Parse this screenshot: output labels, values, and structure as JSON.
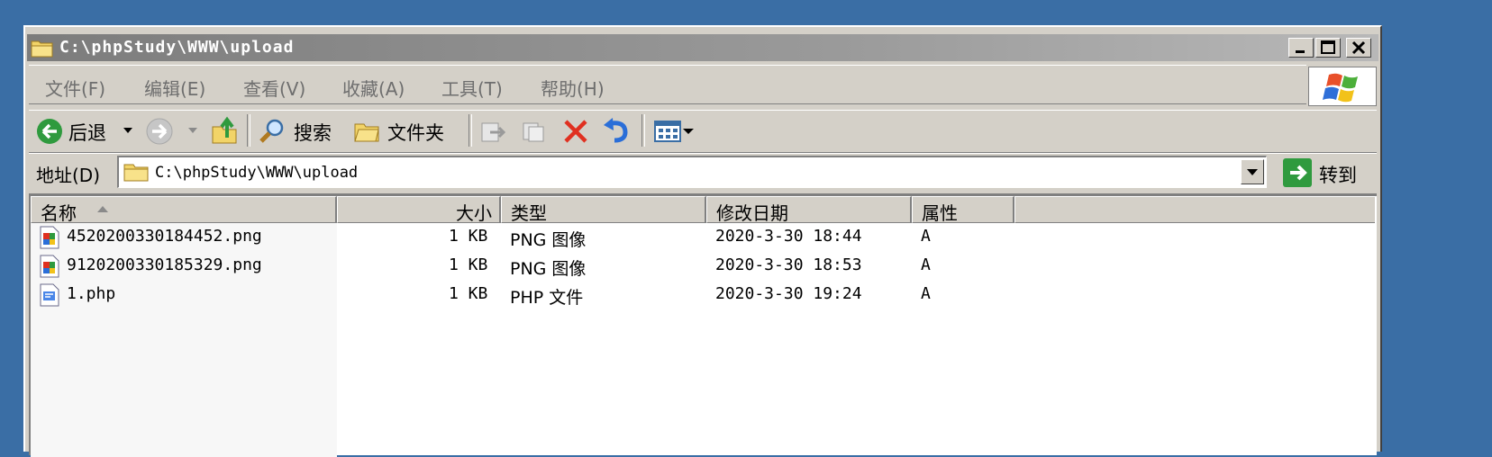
{
  "window": {
    "title": "C:\\phpStudy\\WWW\\upload",
    "controls": [
      "minimize",
      "maximize",
      "close"
    ]
  },
  "menu": [
    {
      "label": "文件(F)"
    },
    {
      "label": "编辑(E)"
    },
    {
      "label": "查看(V)"
    },
    {
      "label": "收藏(A)"
    },
    {
      "label": "工具(T)"
    },
    {
      "label": "帮助(H)"
    }
  ],
  "toolbar": {
    "back_label": "后退",
    "search_label": "搜索",
    "folders_label": "文件夹"
  },
  "address": {
    "label": "地址(D)",
    "value": "C:\\phpStudy\\WWW\\upload",
    "go_label": "转到"
  },
  "columns": {
    "name": "名称",
    "size": "大小",
    "type": "类型",
    "modified": "修改日期",
    "attributes": "属性"
  },
  "files": [
    {
      "name": "4520200330184452.png",
      "size": "1 KB",
      "type": "PNG 图像",
      "modified": "2020-3-30 18:44",
      "attr": "A",
      "icon": "png-file-icon"
    },
    {
      "name": "9120200330185329.png",
      "size": "1 KB",
      "type": "PNG 图像",
      "modified": "2020-3-30 18:53",
      "attr": "A",
      "icon": "png-file-icon"
    },
    {
      "name": "1.php",
      "size": "1 KB",
      "type": "PHP 文件",
      "modified": "2020-3-30 19:24",
      "attr": "A",
      "icon": "php-file-icon"
    }
  ],
  "colors": {
    "desktop": "#3a6ea5",
    "chrome": "#d4d0c8",
    "titlebar_inactive": "#9a9a9a",
    "close_icon_red": "#e03020",
    "back_icon_green": "#2f9a3e"
  }
}
